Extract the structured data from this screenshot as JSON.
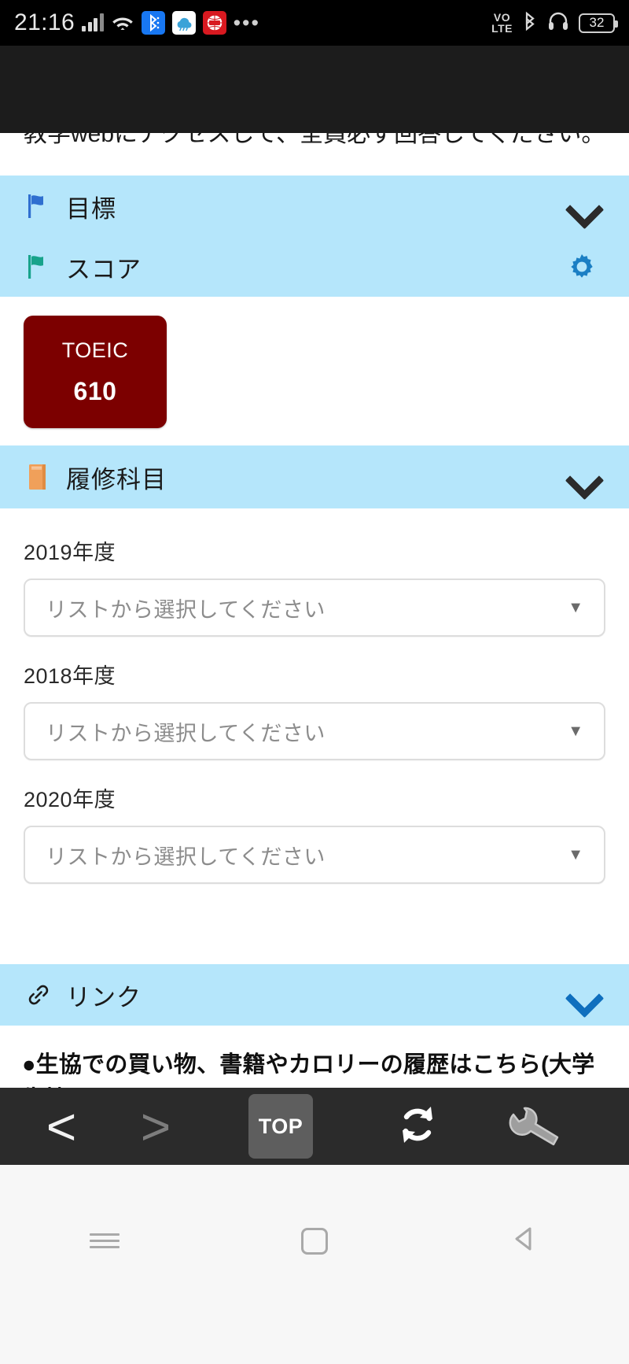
{
  "status_bar": {
    "time": "21:16",
    "icons_left": [
      "signal-bars-icon",
      "wifi-icon",
      "bluetooth-share-icon",
      "cloud-app-icon",
      "red-app-icon",
      "more-dots-icon"
    ],
    "volte_top": "VO",
    "volte_bottom": "LTE",
    "icons_right": [
      "volte-icon",
      "bluetooth-icon",
      "headphones-icon"
    ],
    "battery_level": "32"
  },
  "page": {
    "clipped_notice": "教学webにアクセスして、全員必ず回答してください。",
    "sections": {
      "goal": {
        "label": "目標",
        "icon": "blue-flag-icon",
        "action": "chevron-down-icon"
      },
      "score": {
        "label": "スコア",
        "icon": "green-flag-icon",
        "action": "gear-icon",
        "cards": [
          {
            "name": "TOEIC",
            "value": "610",
            "color": "#7c0000"
          }
        ]
      },
      "courses": {
        "label": "履修科目",
        "icon": "orange-book-icon",
        "action": "chevron-down-icon",
        "fields": [
          {
            "label": "2019年度",
            "value": "リストから選択してください",
            "caret": "▼"
          },
          {
            "label": "2018年度",
            "value": "リストから選択してください",
            "caret": "▼"
          },
          {
            "label": "2020年度",
            "value": "リストから選択してください",
            "caret": "▼"
          }
        ]
      },
      "links": {
        "label": "リンク",
        "icon": "chain-link-icon",
        "action": "chevron-down-icon",
        "body": "●生協での買い物、書籍やカロリーの履歴はこちら(大学生協マイページ)"
      }
    }
  },
  "toolbar": {
    "back": "<",
    "forward": ">",
    "top_label": "TOP",
    "reload": "reload-icon",
    "tools": "wrench-icon"
  },
  "navbar": {
    "recents": "recents-icon",
    "home": "home-icon",
    "back": "back-triangle-icon"
  },
  "colors": {
    "band": "#b5e6fb",
    "score_card": "#7c0000",
    "toolbar": "#2b2b2b",
    "status_bar": "#000000",
    "accent_blue": "#0f6fbe",
    "flag_blue": "#2f6fd0",
    "flag_green": "#17a38b",
    "book_orange": "#f0a05a"
  }
}
